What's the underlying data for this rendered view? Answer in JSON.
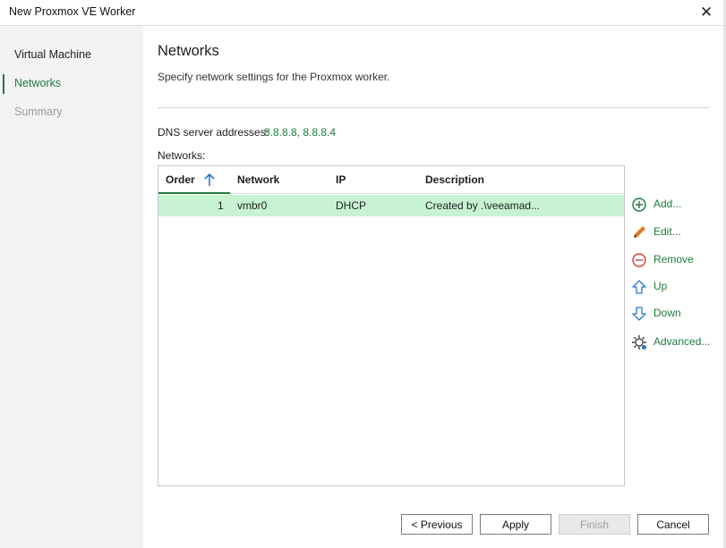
{
  "window": {
    "title": "New Proxmox VE Worker"
  },
  "sidebar": {
    "items": [
      {
        "label": "Virtual Machine",
        "state": "done"
      },
      {
        "label": "Networks",
        "state": "active"
      },
      {
        "label": "Summary",
        "state": "pending"
      }
    ]
  },
  "page": {
    "title": "Networks",
    "subtitle": "Specify network settings for the Proxmox worker."
  },
  "dns": {
    "label": "DNS server addresses:",
    "value": "8.8.8.8, 8.8.8.4"
  },
  "networks": {
    "label": "Networks:",
    "columns": [
      "Order",
      "Network",
      "IP",
      "Description"
    ],
    "sort_column": "Order",
    "rows": [
      {
        "order": "1",
        "network": "vmbr0",
        "ip": "DHCP",
        "description": "Created by .\\veeamad..."
      }
    ]
  },
  "actions": {
    "add": "Add...",
    "edit": "Edit...",
    "remove": "Remove",
    "up": "Up",
    "down": "Down",
    "advanced": "Advanced..."
  },
  "footer": {
    "previous": "< Previous",
    "apply": "Apply",
    "finish": "Finish",
    "cancel": "Cancel",
    "finish_enabled": false
  },
  "colors": {
    "accent": "#1e7a3d",
    "selected_row": "#c7f3d3",
    "sidebar_bg": "#f3f3f3",
    "icon_blue": "#2a78c8",
    "remove_red": "#d83b3b",
    "edit_orange": "#e07b2a"
  }
}
